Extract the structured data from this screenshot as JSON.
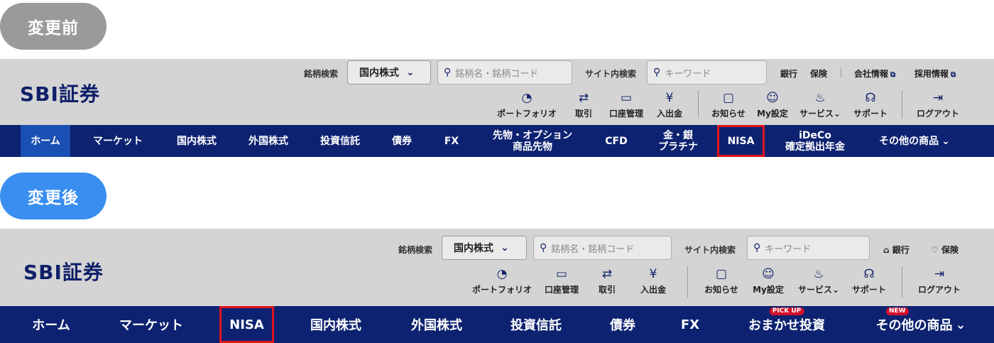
{
  "labels": {
    "before": "変更前",
    "after": "変更後"
  },
  "logo": "SBI証券",
  "before": {
    "stock_search_label": "銘柄検索",
    "stock_select": "国内株式",
    "stock_placeholder": "銘柄名・銘柄コード",
    "site_search_label": "サイト内検索",
    "site_placeholder": "キーワード",
    "links": [
      "銀行",
      "保険",
      "会社情報",
      "採用情報"
    ],
    "icons": [
      {
        "icon": "pie-chart-icon",
        "label": "ポートフォリオ"
      },
      {
        "icon": "transfer-icon",
        "label": "取引"
      },
      {
        "icon": "card-icon",
        "label": "口座管理"
      },
      {
        "icon": "yen-icon",
        "label": "入出金"
      },
      {
        "icon": "chat-icon",
        "label": "お知らせ"
      },
      {
        "icon": "user-icon",
        "label": "My設定"
      },
      {
        "icon": "service-icon",
        "label": "サービス"
      },
      {
        "icon": "headset-icon",
        "label": "サポート"
      },
      {
        "icon": "logout-icon",
        "label": "ログアウト"
      }
    ],
    "nav": [
      "ホーム",
      "マーケット",
      "国内株式",
      "外国株式",
      "投資信託",
      "債券",
      "FX",
      "先物・オプション\n商品先物",
      "CFD",
      "金・銀\nプラチナ",
      "NISA",
      "iDeCo\n確定拠出年金",
      "その他の商品"
    ]
  },
  "after": {
    "stock_search_label": "銘柄検索",
    "stock_select": "国内株式",
    "stock_placeholder": "銘柄名・銘柄コード",
    "site_search_label": "サイト内検索",
    "site_placeholder": "キーワード",
    "links": [
      "銀行",
      "保険"
    ],
    "icons": [
      {
        "icon": "pie-chart-icon",
        "label": "ポートフォリオ"
      },
      {
        "icon": "card-icon",
        "label": "口座管理"
      },
      {
        "icon": "transfer-icon",
        "label": "取引"
      },
      {
        "icon": "yen-icon",
        "label": "入出金"
      },
      {
        "icon": "chat-icon",
        "label": "お知らせ"
      },
      {
        "icon": "user-icon",
        "label": "My設定"
      },
      {
        "icon": "service-icon",
        "label": "サービス"
      },
      {
        "icon": "headset-icon",
        "label": "サポート"
      },
      {
        "icon": "logout-icon",
        "label": "ログアウト"
      }
    ],
    "nav": [
      "ホーム",
      "マーケット",
      "NISA",
      "国内株式",
      "外国株式",
      "投資信託",
      "債券",
      "FX",
      "おまかせ投資",
      "その他の商品"
    ],
    "badges": {
      "pickup": "PICK UP",
      "new": "NEW"
    }
  },
  "colors": {
    "nav_bg": "#0d2270",
    "header_bg": "#d4d4d4",
    "highlight": "#e0141e",
    "active": "#1a4fb3"
  }
}
